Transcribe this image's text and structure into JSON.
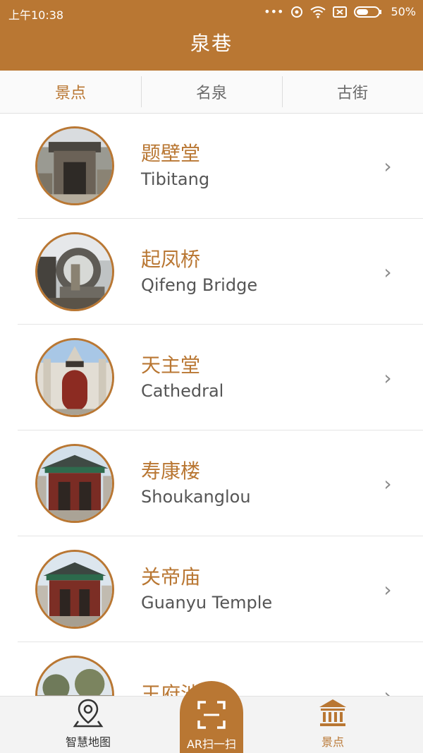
{
  "status": {
    "time": "上午10:38",
    "battery": "50%"
  },
  "header": {
    "title": "泉巷"
  },
  "tabs": [
    {
      "label": "景点",
      "active": true
    },
    {
      "label": "名泉",
      "active": false
    },
    {
      "label": "古街",
      "active": false
    }
  ],
  "list": [
    {
      "name_cn": "题壁堂",
      "name_en": "Tibitang"
    },
    {
      "name_cn": "起凤桥",
      "name_en": "Qifeng Bridge"
    },
    {
      "name_cn": "天主堂",
      "name_en": "Cathedral"
    },
    {
      "name_cn": "寿康楼",
      "name_en": "Shoukanglou"
    },
    {
      "name_cn": "关帝庙",
      "name_en": "Guanyu Temple"
    },
    {
      "name_cn": "王府池子",
      "name_en": ""
    }
  ],
  "bottom_nav": {
    "map_label": "智慧地图",
    "ar_label": "AR扫一扫",
    "sights_label": "景点"
  },
  "colors": {
    "accent": "#B97733"
  }
}
